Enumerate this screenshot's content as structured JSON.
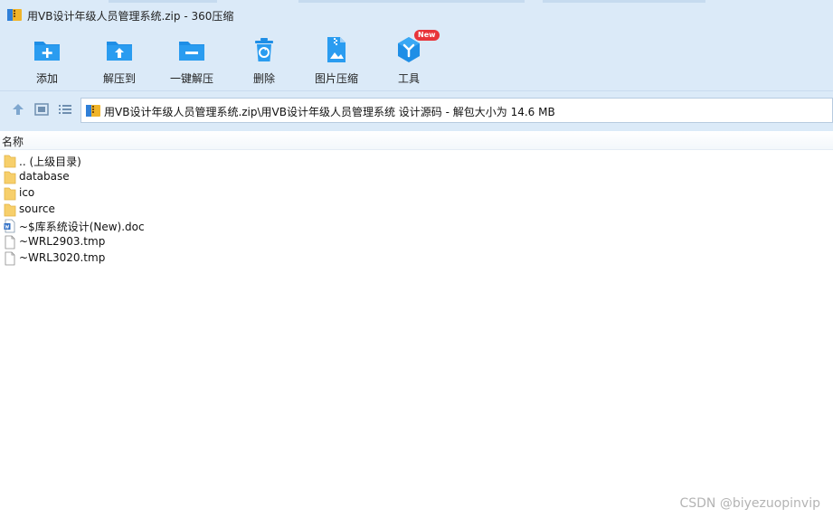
{
  "window": {
    "title": "用VB设计年级人员管理系统.zip - 360压缩"
  },
  "toolbar": {
    "items": [
      {
        "label": "添加",
        "icon": "add-folder-icon"
      },
      {
        "label": "解压到",
        "icon": "extract-to-icon"
      },
      {
        "label": "一键解压",
        "icon": "one-click-extract-icon"
      },
      {
        "label": "删除",
        "icon": "delete-icon"
      },
      {
        "label": "图片压缩",
        "icon": "image-compress-icon"
      },
      {
        "label": "工具",
        "icon": "tools-icon",
        "badge": "New"
      }
    ]
  },
  "navbar": {
    "path": "用VB设计年级人员管理系统.zip\\用VB设计年级人员管理系统 设计源码 - 解包大小为 14.6 MB"
  },
  "list": {
    "column_name": "名称",
    "rows": [
      {
        "name": ".. (上级目录)",
        "icon": "folder-icon"
      },
      {
        "name": "database",
        "icon": "folder-icon"
      },
      {
        "name": "ico",
        "icon": "folder-icon"
      },
      {
        "name": "source",
        "icon": "folder-icon"
      },
      {
        "name": "~$库系统设计(New).doc",
        "icon": "word-doc-icon"
      },
      {
        "name": "~WRL2903.tmp",
        "icon": "file-icon"
      },
      {
        "name": "~WRL3020.tmp",
        "icon": "file-icon"
      }
    ]
  },
  "watermark": "CSDN @biyezuopinvip",
  "colors": {
    "chrome": "#dbeaf8",
    "icon_blue": "#1e8ee6",
    "badge": "#e8343a",
    "folder": "#f7cf6b"
  }
}
